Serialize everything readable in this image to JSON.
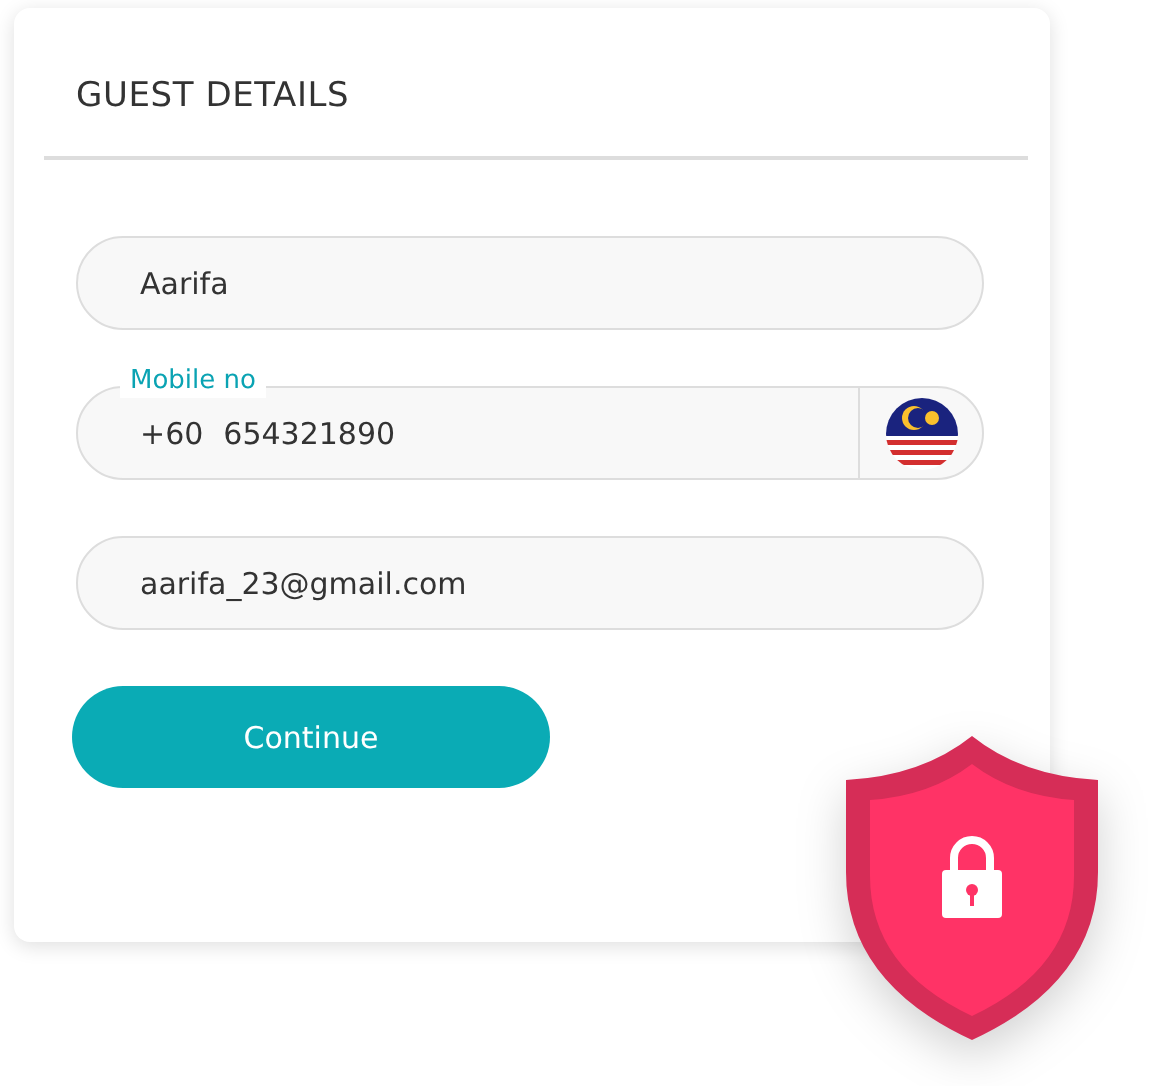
{
  "card": {
    "title": "GUEST DETAILS"
  },
  "fields": [
    {
      "kind": "text",
      "value": "Aarifa"
    },
    {
      "kind": "phone",
      "label": "Mobile no",
      "prefix": "+60",
      "value": "654321890"
    },
    {
      "kind": "text",
      "value": "aarifa_23@gmail.com"
    }
  ],
  "button": {
    "label": "Continue"
  }
}
